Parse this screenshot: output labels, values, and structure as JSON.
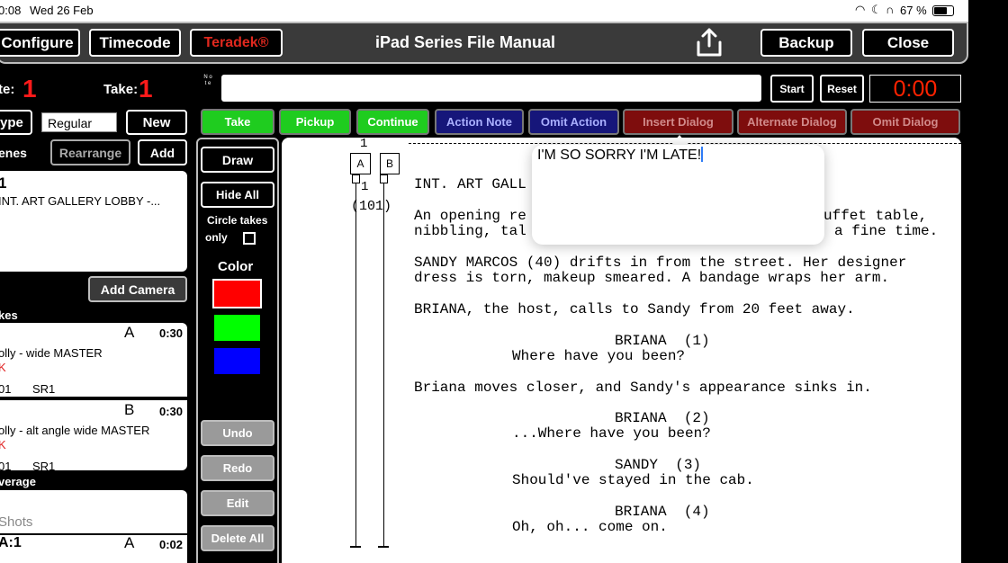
{
  "status": {
    "time": "0:08",
    "date": "Wed 26 Feb",
    "battery": "67 %"
  },
  "header": {
    "configure": "Configure",
    "timecode": "Timecode",
    "teradek": "Teradek®",
    "title": "iPad Series File Manual",
    "backup": "Backup",
    "close": "Close"
  },
  "slate": {
    "scene_label": "te:",
    "scene_value": "1",
    "take_label": "Take:",
    "take_value": "1"
  },
  "note": {
    "label": "N o t e",
    "value": ""
  },
  "timer": {
    "start": "Start",
    "reset": "Reset",
    "display": "0:00"
  },
  "type_row": {
    "label": "ype",
    "value": "Regular",
    "new": "New"
  },
  "scenes_row": {
    "label": "enes",
    "rearrange": "Rearrange",
    "add": "Add"
  },
  "scene_card": {
    "number": "1",
    "text": "INT. ART GALLERY LOBBY -..."
  },
  "add_camera": "Add Camera",
  "takes": {
    "header": "kes",
    "items": [
      {
        "cam": "A",
        "duration": "0:30",
        "desc": "olly - wide MASTER",
        "mark": "K",
        "roll": "01",
        "sr": "SR1"
      },
      {
        "cam": "B",
        "duration": "0:30",
        "desc": "olly - alt angle wide MASTER",
        "mark": "K",
        "roll": "01",
        "sr": "SR1"
      }
    ]
  },
  "coverage": {
    "header": "verage",
    "shots": "Shots",
    "shot_id": "A:1",
    "shot_cam": "A",
    "shot_duration": "0:02"
  },
  "tools": {
    "draw": "Draw",
    "hide_all": "Hide All",
    "circle_takes": "Circle takes",
    "only": "only",
    "color_label": "Color",
    "colors": [
      "#ff0000",
      "#00ff00",
      "#0000ff"
    ],
    "undo": "Undo",
    "redo": "Redo",
    "edit": "Edit",
    "delete_all": "Delete All"
  },
  "actions": {
    "take": "Take",
    "pickup": "Pickup",
    "continue": "Continue",
    "action_note": "Action Note",
    "omit_action": "Omit Action",
    "insert_dialog": "Insert Dialog",
    "alternate_dialog": "Alternate Dialog",
    "omit_dialog": "Omit Dialog"
  },
  "script": {
    "page_num": "1",
    "lane_a": "A",
    "lane_b": "B",
    "lane_num": "1",
    "lane_count": "(101)",
    "lines": [
      "INT. ART GALL",
      "An opening re",
      "uffet table,",
      "nibbling, tal",
      "a fine time.",
      "SANDY MARCOS (40) drifts in from the street. Her designer",
      "dress is torn, makeup smeared. A bandage wraps her arm.",
      "BRIANA, the host, calls to Sandy from 20 feet away.",
      "BRIANA  (1)",
      "Where have you been?",
      "Briana moves closer, and Sandy's appearance sinks in.",
      "BRIANA  (2)",
      "...Where have you been?",
      "SANDY  (3)",
      "Should've stayed in the cab.",
      "BRIANA  (4)",
      "Oh, oh... come on."
    ]
  },
  "popover": {
    "text": "I'M SO SORRY I'M LATE!"
  },
  "palette": {
    "take_green": "#1fcc1f",
    "action_blue": "#16167a",
    "dialog_red": "#7e0d0d",
    "timer_red": "#ff2200"
  }
}
